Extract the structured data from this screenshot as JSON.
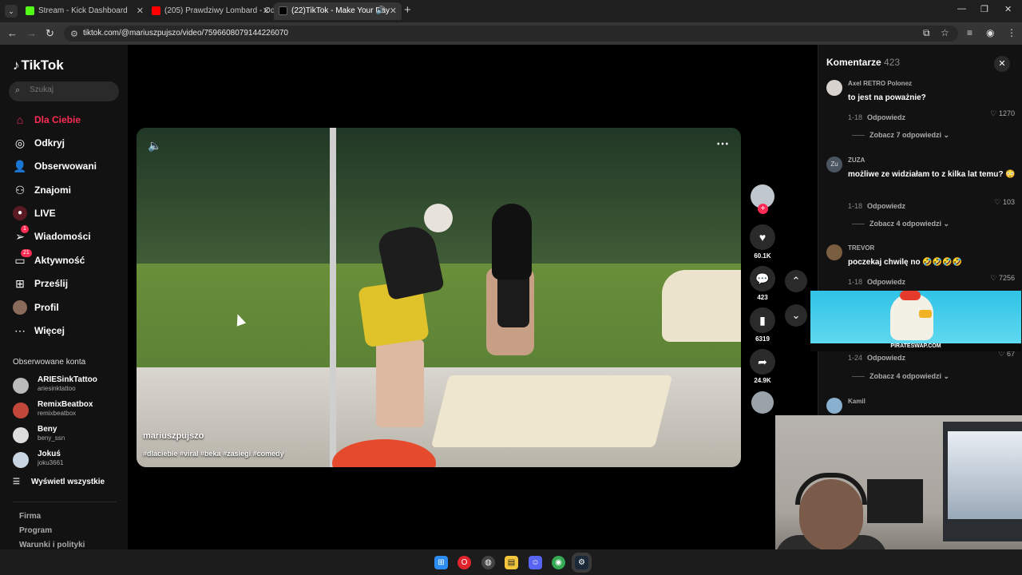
{
  "browser": {
    "tabs": [
      {
        "title": "Stream - Kick Dashboard",
        "color": "#53fc18"
      },
      {
        "title": "(205) Prawdziwy Lombard - Od",
        "color": "#ff0000"
      },
      {
        "title": "(22)TikTok - Make Your Day",
        "color": "#ffffff"
      }
    ],
    "url": "tiktok.com/@mariuszpujszo/video/7596608079144226070"
  },
  "sidebar": {
    "logo": "TikTok",
    "search_placeholder": "Szukaj",
    "nav": [
      {
        "label": "Dla Ciebie",
        "icon": "home-icon"
      },
      {
        "label": "Odkryj",
        "icon": "compass-icon"
      },
      {
        "label": "Obserwowani",
        "icon": "user-plus-icon"
      },
      {
        "label": "Znajomi",
        "icon": "friends-icon"
      },
      {
        "label": "LIVE",
        "icon": "live-icon"
      },
      {
        "label": "Wiadomości",
        "icon": "paper-plane-icon",
        "badge": "1"
      },
      {
        "label": "Aktywność",
        "icon": "activity-icon",
        "badge": "21"
      },
      {
        "label": "Prześlij",
        "icon": "upload-icon"
      },
      {
        "label": "Profil",
        "icon": "profile-icon"
      },
      {
        "label": "Więcej",
        "icon": "more-icon"
      }
    ],
    "following_title": "Obserwowane konta",
    "accounts": [
      {
        "name": "ARIESinkTattoo",
        "handle": "ariesinktattoo"
      },
      {
        "name": "RemixBeatbox",
        "handle": "remixbeatbox"
      },
      {
        "name": "Beny",
        "handle": "beny_ssn"
      },
      {
        "name": "Jokuś",
        "handle": "joku3661"
      }
    ],
    "show_all": "Wyświetl wszystkie",
    "footer": [
      "Firma",
      "Program",
      "Warunki i polityki"
    ]
  },
  "video": {
    "author": "mariuszpujszo",
    "hashtags": "#dlaciebie #viral #beka #zasiegi #comedy"
  },
  "actions": {
    "likes": "60.1K",
    "comments": "423",
    "saves": "6319",
    "shares": "24.9K"
  },
  "comments_panel": {
    "title": "Komentarze",
    "count": "423",
    "items": [
      {
        "user": "Axel RETRO Polonez",
        "text": "to jest na poważnie?",
        "date": "1-18",
        "reply": "Odpowiedz",
        "likes": "1270",
        "replies": "Zobacz 7 odpowiedzi"
      },
      {
        "user": "ZUZA",
        "avatar": "Zu",
        "text": "możliwe ze widziałam to z kilka lat temu? 😳",
        "date": "1-18",
        "reply": "Odpowiedz",
        "likes": "103",
        "replies": "Zobacz 4 odpowiedzi"
      },
      {
        "user": "TREVOR",
        "text": "poczekaj chwilę no 🤣🤣🤣🤣",
        "date": "1-18",
        "reply": "Odpowiedz",
        "likes": "7256"
      },
      {
        "date": "1-24",
        "reply": "Odpowiedz",
        "likes": "67",
        "replies": "Zobacz 4 odpowiedzi"
      },
      {
        "user": "Kamil"
      }
    ]
  },
  "ad": {
    "label": "PIRATESWAP.COM"
  },
  "taskbar": {
    "apps": [
      {
        "icon": "windows-icon",
        "color": "#2d8cf0"
      },
      {
        "icon": "opera-icon",
        "color": "#e0242b"
      },
      {
        "icon": "obs-icon",
        "color": "#444444"
      },
      {
        "icon": "files-icon",
        "color": "#f2c53d"
      },
      {
        "icon": "discord-icon",
        "color": "#5865f2"
      },
      {
        "icon": "chrome-icon",
        "color": "#34a853"
      },
      {
        "icon": "steam-icon",
        "color": "#1b2838"
      }
    ]
  }
}
